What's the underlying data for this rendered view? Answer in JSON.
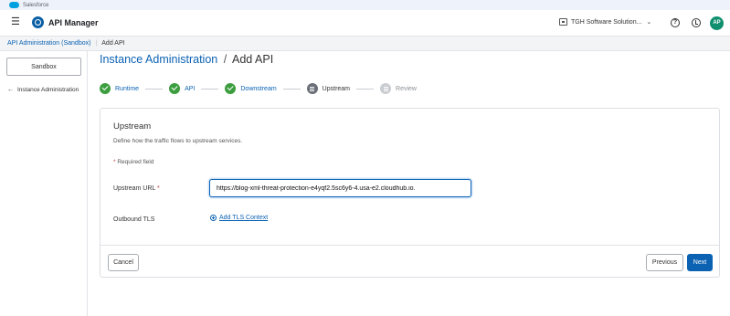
{
  "browser_tab": {
    "label": "Salesforce"
  },
  "header": {
    "app_title": "API Manager",
    "org_name": "TGH Software Solution...",
    "help_icon": "question-circle-icon",
    "notifications_icon": "clock-icon",
    "avatar_initials": "AP"
  },
  "breadcrumb": {
    "parent": "API Administration (Sandbox)",
    "current": "Add API"
  },
  "sidebar": {
    "environment_button": "Sandbox",
    "back_link": "Instance Administration"
  },
  "page": {
    "title_link": "Instance Administration",
    "title_separator": "/",
    "title_current": "Add API"
  },
  "stepper": {
    "steps": [
      {
        "label": "Runtime",
        "state": "done"
      },
      {
        "label": "API",
        "state": "done"
      },
      {
        "label": "Downstream",
        "state": "done"
      },
      {
        "label": "Upstream",
        "state": "current"
      },
      {
        "label": "Review",
        "state": "pending"
      }
    ]
  },
  "form": {
    "title": "Upstream",
    "description": "Define how the traffic flows to upstream services.",
    "required_note": "Required field",
    "upstream_url_label": "Upstream URL",
    "upstream_url_value": "https://blog-xml-threat-protection-e4yqf2.5sc6y6-4.usa-e2.cloudhub.io.",
    "outbound_tls_label": "Outbound TLS",
    "add_tls_link": "Add TLS Context"
  },
  "buttons": {
    "cancel": "Cancel",
    "previous": "Previous",
    "next": "Next"
  },
  "colors": {
    "accent": "#0b62b3",
    "success": "#3c9e3f",
    "avatar": "#0f8f6e"
  }
}
